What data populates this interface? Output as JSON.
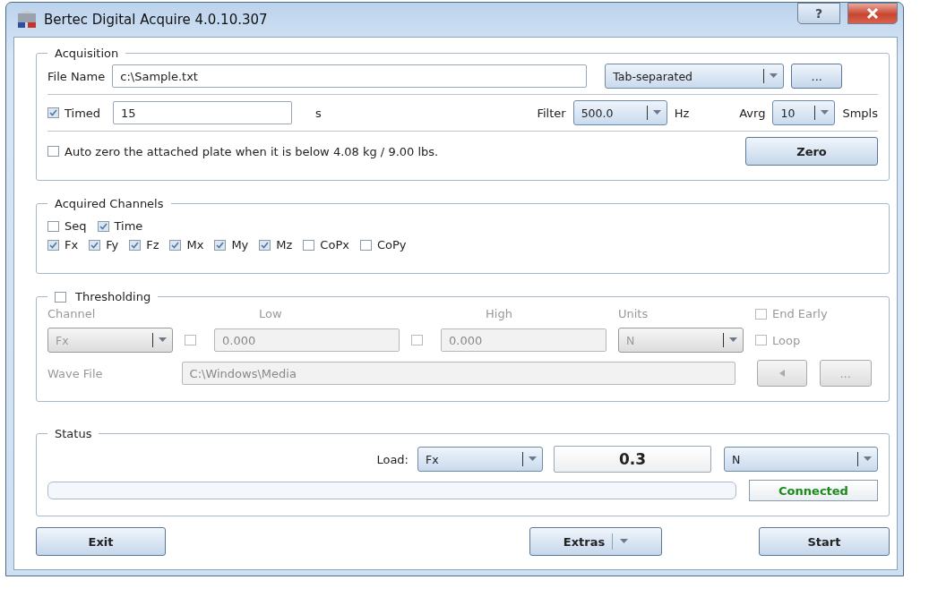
{
  "window": {
    "title": "Bertec Digital Acquire 4.0.10.307",
    "help_button": "?"
  },
  "acquisition": {
    "legend": "Acquisition",
    "file_name_label": "File Name",
    "file_name": "c:\\Sample.txt",
    "format": "Tab-separated",
    "browse_button": "...",
    "timed": {
      "label": "Timed",
      "checked": true
    },
    "duration": "15",
    "duration_unit": "s",
    "filter_label": "Filter",
    "filter": "500.0",
    "filter_unit": "Hz",
    "avrg_label": "Avrg",
    "avrg": "10",
    "avrg_unit": "Smpls",
    "auto_zero": {
      "label": "Auto zero the attached plate when it is below 4.08 kg / 9.00 lbs.",
      "checked": false
    },
    "zero_button": "Zero"
  },
  "acquired_channels": {
    "legend": "Acquired Channels",
    "rows": [
      {
        "items": [
          {
            "label": "Seq",
            "checked": false
          },
          {
            "label": "Time",
            "checked": true
          }
        ]
      },
      {
        "items": [
          {
            "label": "Fx",
            "checked": true
          },
          {
            "label": "Fy",
            "checked": true
          },
          {
            "label": "Fz",
            "checked": true
          },
          {
            "label": "Mx",
            "checked": true
          },
          {
            "label": "My",
            "checked": true
          },
          {
            "label": "Mz",
            "checked": true
          },
          {
            "label": "CoPx",
            "checked": false
          },
          {
            "label": "CoPy",
            "checked": false
          }
        ]
      }
    ]
  },
  "thresholding": {
    "legend": "Thresholding",
    "checked": false,
    "channel_label": "Channel",
    "low_label": "Low",
    "high_label": "High",
    "units_label": "Units",
    "channel": "Fx",
    "low_checked": false,
    "low": "0.000",
    "high_checked": false,
    "high": "0.000",
    "units": "N",
    "end_early": {
      "label": "End Early",
      "checked": false
    },
    "loop": {
      "label": "Loop",
      "checked": false
    },
    "wave_file_label": "Wave File",
    "wave_file": "C:\\Windows\\Media",
    "browse_button": "..."
  },
  "status": {
    "legend": "Status",
    "load_label": "Load:",
    "load_channel": "Fx",
    "load_value": "0.3",
    "load_unit": "N",
    "connection": "Connected"
  },
  "buttons": {
    "exit": "Exit",
    "extras": "Extras",
    "start": "Start"
  }
}
